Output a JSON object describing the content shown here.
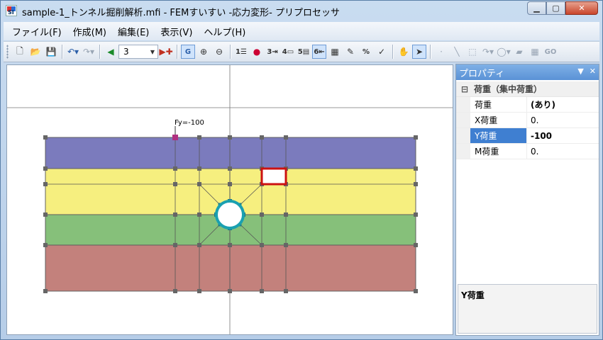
{
  "window": {
    "title": "sample-1_トンネル掘削解析.mfi - FEMすいすい -応力変形- プリプロセッサ",
    "app_icon_label": "SI"
  },
  "menu": [
    "ファイル(F)",
    "作成(M)",
    "編集(E)",
    "表示(V)",
    "ヘルプ(H)"
  ],
  "toolbar": {
    "step_value": "3",
    "icons": [
      "new-file-icon",
      "open-folder-icon",
      "save-icon",
      "undo-icon",
      "redo-icon",
      "back-arrow-icon",
      "add-step-icon",
      "grid-snap-icon",
      "zoom-in-icon",
      "zoom-out-icon",
      "hand-pan-icon",
      "pointer-icon"
    ]
  },
  "canvas": {
    "load_label": "Fy=-100",
    "colors": {
      "layer1": "#7b7bbd",
      "layer2": "#f6ef7f",
      "layer3": "#86c07a",
      "layer4": "#c3817c",
      "selection": "#cc1111",
      "tunnel": "#1aa0b0",
      "load_node": "#b03080"
    }
  },
  "panel": {
    "title": "プロパティ",
    "category": "荷重（集中荷重）",
    "rows": [
      {
        "name": "荷重",
        "value": "(あり)",
        "bold": true
      },
      {
        "name": "X荷重",
        "value": "0."
      },
      {
        "name": "Y荷重",
        "value": "-100",
        "bold": true,
        "selected": true
      },
      {
        "name": "M荷重",
        "value": "0."
      }
    ],
    "description": "Y荷重"
  }
}
